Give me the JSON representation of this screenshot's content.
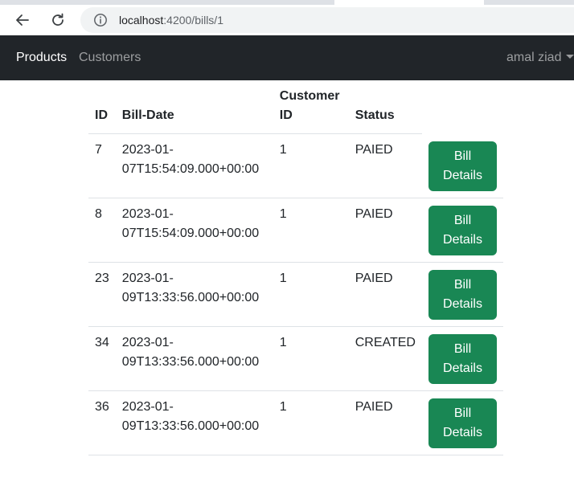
{
  "browser": {
    "url_host": "localhost",
    "url_path": ":4200/bills/1"
  },
  "navbar": {
    "brand": "Products",
    "links": [
      "Customers"
    ],
    "user": "amal ziad"
  },
  "table": {
    "headers": {
      "id": "ID",
      "date": "Bill-Date",
      "customer_line1": "Customer",
      "customer_line2": "ID",
      "status": "Status"
    },
    "button_line1": "Bill",
    "button_line2": "Details",
    "rows": [
      {
        "id": "7",
        "date_line1": "2023-01-",
        "date_line2": "07T15:54:09.000+00:00",
        "customer_id": "1",
        "status": "PAIED"
      },
      {
        "id": "8",
        "date_line1": "2023-01-",
        "date_line2": "07T15:54:09.000+00:00",
        "customer_id": "1",
        "status": "PAIED"
      },
      {
        "id": "23",
        "date_line1": "2023-01-",
        "date_line2": "09T13:33:56.000+00:00",
        "customer_id": "1",
        "status": "PAIED"
      },
      {
        "id": "34",
        "date_line1": "2023-01-",
        "date_line2": "09T13:33:56.000+00:00",
        "customer_id": "1",
        "status": "CREATED"
      },
      {
        "id": "36",
        "date_line1": "2023-01-",
        "date_line2": "09T13:33:56.000+00:00",
        "customer_id": "1",
        "status": "PAIED"
      }
    ]
  }
}
